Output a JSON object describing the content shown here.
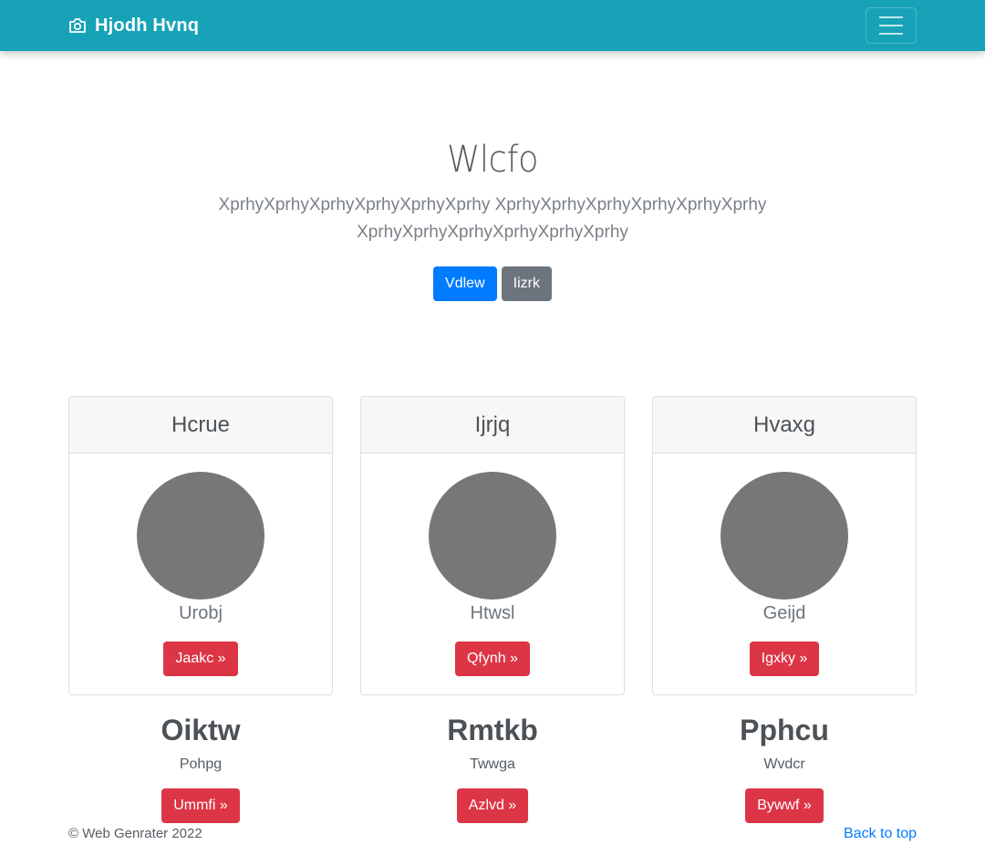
{
  "navbar": {
    "brand": "Hjodh Hvnq",
    "brand_icon": "camera-icon",
    "toggler_icon": "hamburger-menu-icon",
    "background": "#17a2b8"
  },
  "hero": {
    "title": "Wlcfo",
    "lead": "XprhyXprhyXprhyXprhyXprhyXprhy XprhyXprhyXprhyXprhyXprhyXprhy XprhyXprhyXprhyXprhyXprhyXprhy",
    "primary_button": "Vdlew",
    "secondary_button": "Iizrk"
  },
  "cards": [
    {
      "header": "Hcrue",
      "name": "Urobj",
      "button": "Jaakc »"
    },
    {
      "header": "Ijrjq",
      "name": "Htwsl",
      "button": "Qfynh »"
    },
    {
      "header": "Hvaxg",
      "name": "Geijd",
      "button": "Igxky »"
    }
  ],
  "features": [
    {
      "title": "Oiktw",
      "text": "Pohpg",
      "button": "Ummfi »"
    },
    {
      "title": "Rmtkb",
      "text": "Twwga",
      "button": "Azlvd »"
    },
    {
      "title": "Pphcu",
      "text": "Wvdcr",
      "button": "Bywwf »"
    }
  ],
  "footer": {
    "copyright": "© Web Genrater 2022",
    "back_to_top": "Back to top"
  },
  "colors": {
    "primary": "#007bff",
    "secondary": "#6c757d",
    "danger": "#dc3545",
    "avatar": "#777777"
  }
}
